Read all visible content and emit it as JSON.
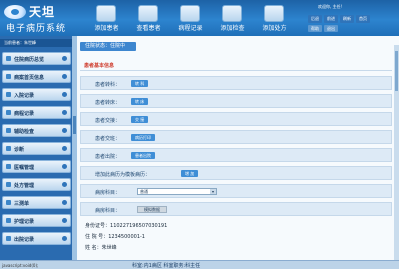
{
  "app": {
    "logo_cn": "天坦",
    "logo_sub": "电子病历系统"
  },
  "toolbar": {
    "buttons": [
      {
        "label": "添加患者",
        "icon": "add-patient-icon"
      },
      {
        "label": "查看患者",
        "icon": "view-patient-icon"
      },
      {
        "label": "病程记录",
        "icon": "record-icon"
      },
      {
        "label": "添加检查",
        "icon": "add-exam-icon"
      },
      {
        "label": "添加处方",
        "icon": "add-prescription-icon"
      }
    ]
  },
  "top_right": {
    "user_line": "欢迎你, 主任!",
    "nav": [
      "后退",
      "前进",
      "刷新",
      "首页"
    ],
    "nav2": [
      "帮助",
      "退出"
    ]
  },
  "sidebar": {
    "current_patient": "当前患者：朱世峰",
    "items": [
      "住院病历总览",
      "病案首页信息",
      "入院记录",
      "病程记录",
      "辅助检查",
      "诊断",
      "医嘱管理",
      "处方管理",
      "三测单",
      "护理记录",
      "出院记录"
    ]
  },
  "content": {
    "status_tab": "住院状态：住院中",
    "section_title": "患者基本信息",
    "rows": [
      {
        "label": "患者转科：",
        "button": "转 科"
      },
      {
        "label": "患者转床：",
        "button": "转 床"
      },
      {
        "label": "患者交接：",
        "button": "交 接"
      },
      {
        "label": "患者交班：",
        "button": "病历打印"
      },
      {
        "label": "患者出院：",
        "button": "患者出院"
      },
      {
        "label": "增加此病历为模板病历：",
        "button": "增 加"
      }
    ],
    "select_row": {
      "label": "病房科目：",
      "value": "普通"
    },
    "box_row": {
      "label": "病房科目：",
      "value": "模拟数据"
    },
    "info": [
      {
        "label": "身份证号：",
        "value": "110227196507030191"
      },
      {
        "label": "住 院 号：",
        "value": "1234500001-1"
      },
      {
        "label": "姓    名：",
        "value": "朱世峰"
      }
    ]
  },
  "statusbar": {
    "js": "javascript:void(0);",
    "dept": "科室:内1病区   科室职务:科主任"
  }
}
